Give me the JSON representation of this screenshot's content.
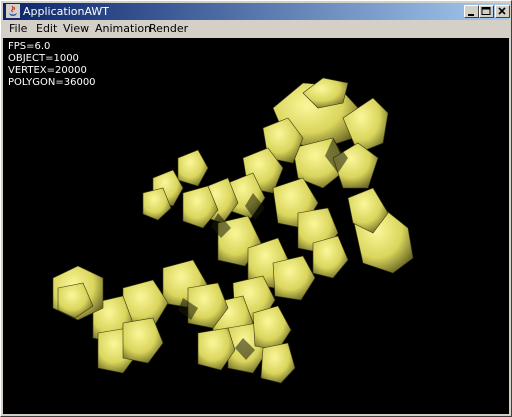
{
  "window": {
    "title": "ApplicationAWT",
    "controls": {
      "minimize": "minimize",
      "maximize": "maximize",
      "close": "close"
    }
  },
  "menu": {
    "items": [
      "File",
      "Edit",
      "View",
      "Animation",
      "Render"
    ]
  },
  "stats": {
    "fps": "FPS=6.0",
    "objects": "OBJECT=1000",
    "vertices": "VERTEX=20000",
    "polygons": "POLYGON=36000"
  },
  "colors": {
    "canvas_background": "#000000",
    "mesh_fill": "#e6e36c",
    "mesh_shade": "#8c8a3a",
    "stats_text": "#ffffff"
  },
  "icons": [
    "java-app-icon",
    "minimize-icon",
    "maximize-icon",
    "close-icon"
  ]
}
